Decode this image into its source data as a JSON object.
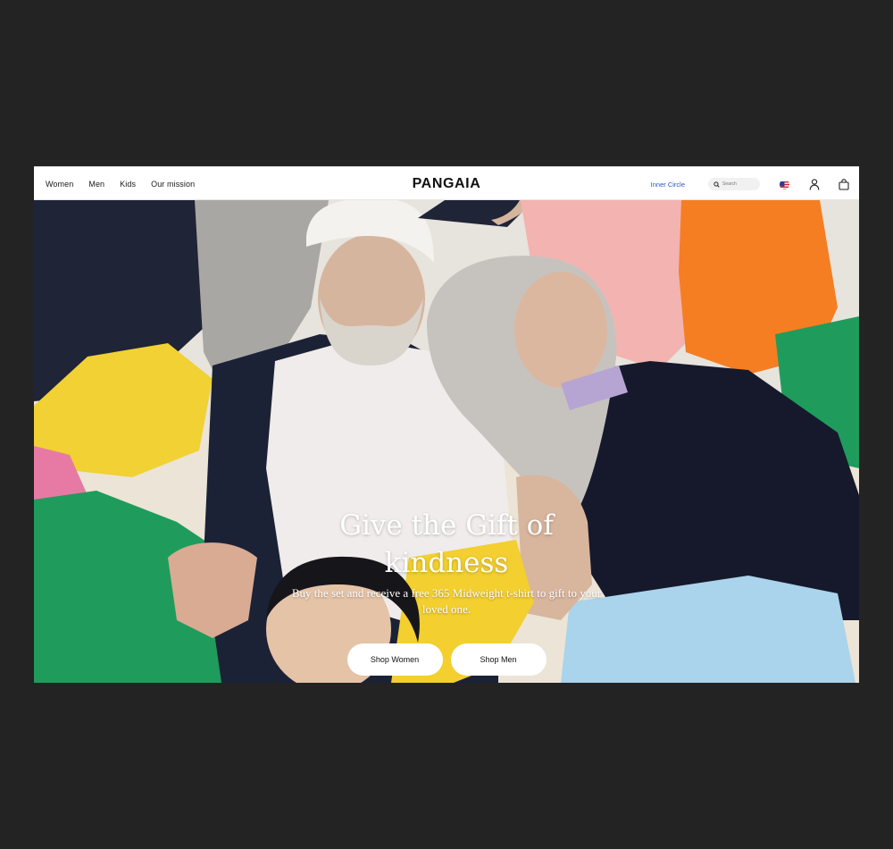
{
  "header": {
    "nav": [
      {
        "label": "Women"
      },
      {
        "label": "Men"
      },
      {
        "label": "Kids"
      },
      {
        "label": "Our mission"
      }
    ],
    "logo": "PANGAIA",
    "inner_circle": "Inner Circle",
    "search_placeholder": "Search",
    "icons": {
      "search": "search-icon",
      "flag": "us-flag-icon",
      "account": "user-icon",
      "bag": "shopping-bag-icon"
    }
  },
  "hero": {
    "headline": "Give the Gift of kindness",
    "subline": "Buy the set and receive a free 365 Midweight t-shirt to gift to your loved one.",
    "cta_women": "Shop Women",
    "cta_men": "Shop Men"
  },
  "colors": {
    "link_blue": "#2a56c6",
    "page_bg": "#232323"
  }
}
